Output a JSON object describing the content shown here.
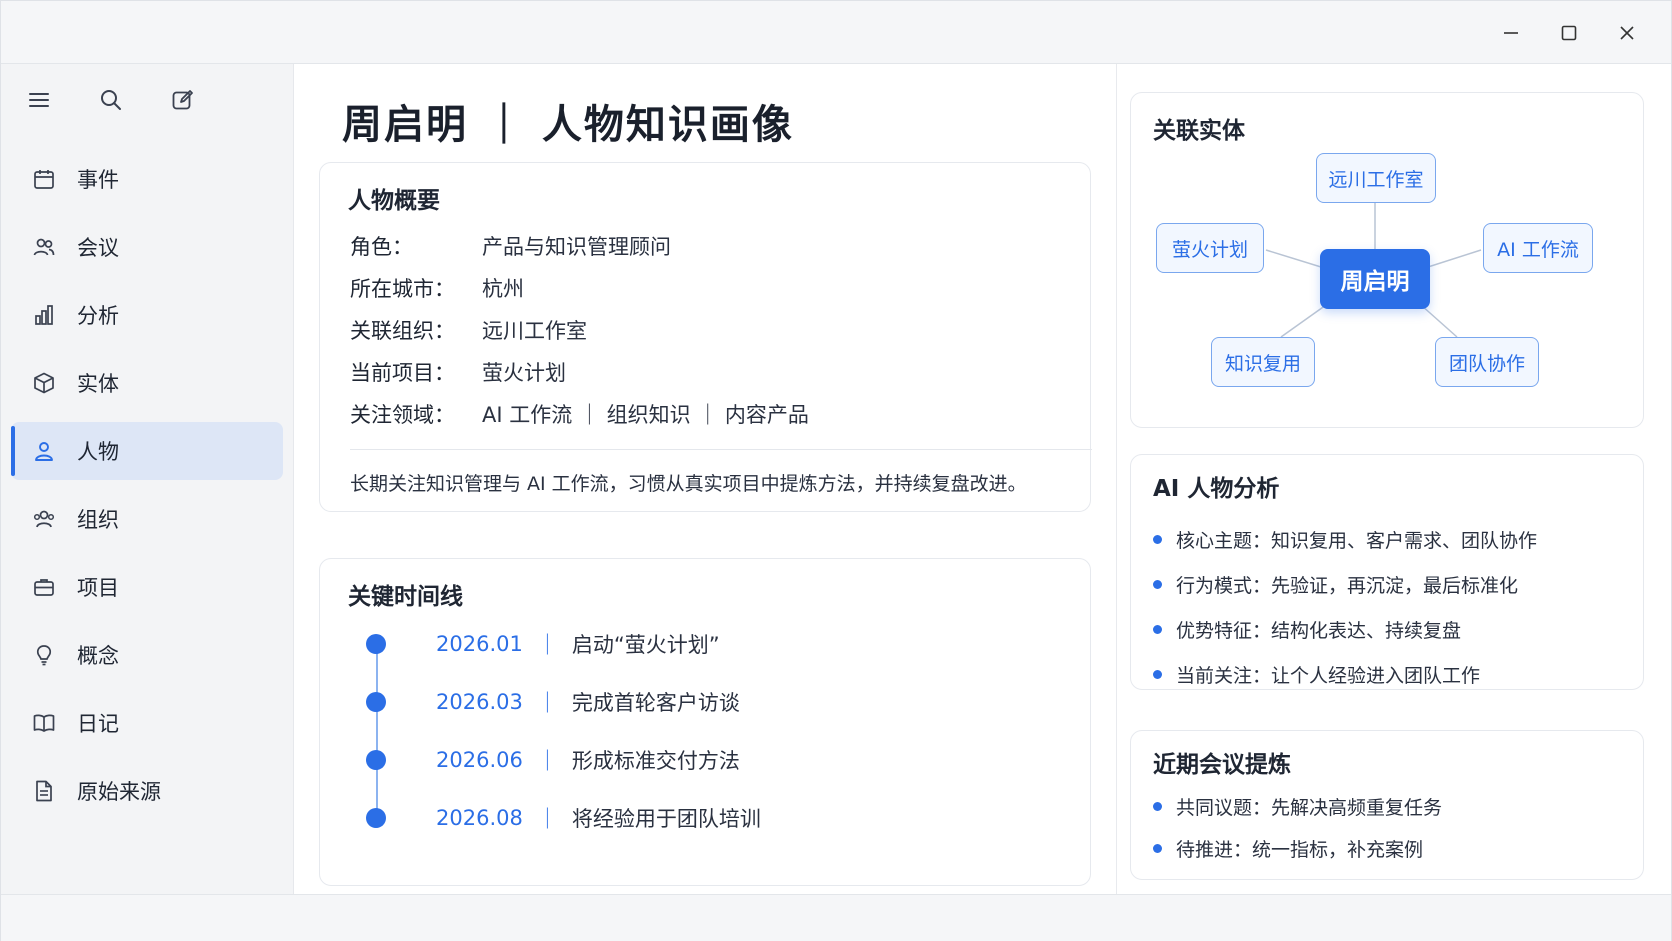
{
  "window": {
    "controls": {
      "minimize_icon": "minimize-icon",
      "maximize_icon": "maximize-icon",
      "close_icon": "close-icon"
    }
  },
  "sidebar": {
    "tools": [
      "menu-icon",
      "search-icon",
      "edit-icon"
    ],
    "items": [
      {
        "label": "事件",
        "icon": "calendar-icon"
      },
      {
        "label": "会议",
        "icon": "users-icon"
      },
      {
        "label": "分析",
        "icon": "bar-chart-icon"
      },
      {
        "label": "实体",
        "icon": "cube-icon"
      },
      {
        "label": "人物",
        "icon": "user-icon",
        "active": true
      },
      {
        "label": "组织",
        "icon": "group-icon"
      },
      {
        "label": "项目",
        "icon": "briefcase-icon"
      },
      {
        "label": "概念",
        "icon": "lightbulb-icon"
      },
      {
        "label": "日记",
        "icon": "book-icon"
      },
      {
        "label": "原始来源",
        "icon": "document-icon"
      }
    ]
  },
  "main": {
    "title": "周启明 ｜ 人物知识画像",
    "profile": {
      "title": "人物概要",
      "rows": [
        {
          "key": "角色：",
          "value": "产品与知识管理顾问"
        },
        {
          "key": "所在城市：",
          "value": "杭州"
        },
        {
          "key": "关联组织：",
          "value": "远川工作室"
        },
        {
          "key": "当前项目：",
          "value": "萤火计划"
        },
        {
          "key": "关注领域：",
          "value": "AI 工作流 ｜ 组织知识 ｜ 内容产品"
        }
      ],
      "description": "长期关注知识管理与 AI 工作流，习惯从真实项目中提炼方法，并持续复盘改进。"
    },
    "timeline": {
      "title": "关键时间线",
      "separator": "｜",
      "events": [
        {
          "date": "2026.01",
          "text": "启动“萤火计划”"
        },
        {
          "date": "2026.03",
          "text": "完成首轮客户访谈"
        },
        {
          "date": "2026.06",
          "text": "形成标准交付方法"
        },
        {
          "date": "2026.08",
          "text": "将经验用于团队培训"
        }
      ]
    }
  },
  "right": {
    "entities": {
      "title": "关联实体",
      "center": "周启明",
      "nodes": [
        "远川工作室",
        "萤火计划",
        "AI 工作流",
        "知识复用",
        "团队协作"
      ]
    },
    "analysis": {
      "title": "AI 人物分析",
      "items": [
        "核心主题：知识复用、客户需求、团队协作",
        "行为模式：先验证，再沉淀，最后标准化",
        "优势特征：结构化表达、持续复盘",
        "当前关注：让个人经验进入团队工作"
      ]
    },
    "meetings": {
      "title": "近期会议提炼",
      "items": [
        "共同议题：先解决高频重复任务",
        "待推进：统一指标，补充案例"
      ]
    }
  },
  "colors": {
    "accent": "#2b6ee6",
    "active_nav_bg": "#dde6f6"
  }
}
